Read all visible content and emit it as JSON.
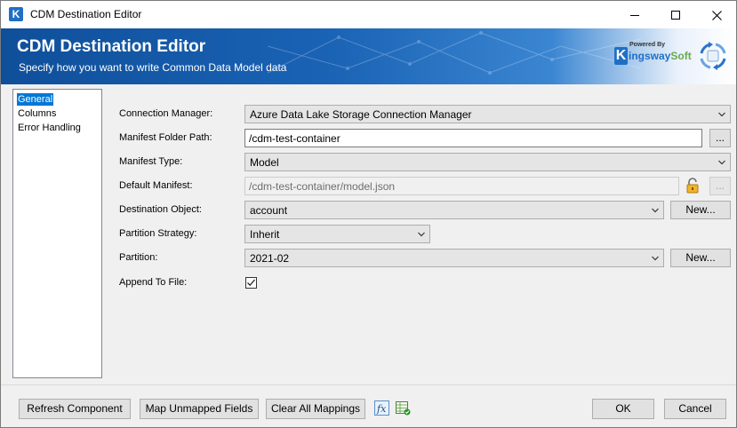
{
  "window": {
    "title": "CDM Destination Editor",
    "app_icon_letter": "K"
  },
  "banner": {
    "title": "CDM Destination Editor",
    "subtitle": "Specify how you want to write Common Data Model data",
    "brand_powered": "Powered By",
    "brand_name_main": "ingsway",
    "brand_name_soft": "Soft",
    "brand_letter": "K"
  },
  "nav": {
    "items": [
      {
        "label": "General",
        "selected": true
      },
      {
        "label": "Columns",
        "selected": false
      },
      {
        "label": "Error Handling",
        "selected": false
      }
    ]
  },
  "form": {
    "connection_manager": {
      "label": "Connection Manager:",
      "value": "Azure Data Lake Storage Connection Manager"
    },
    "manifest_folder_path": {
      "label": "Manifest Folder Path:",
      "value": "/cdm-test-container",
      "browse_label": "..."
    },
    "manifest_type": {
      "label": "Manifest Type:",
      "value": "Model"
    },
    "default_manifest": {
      "label": "Default Manifest:",
      "value": "/cdm-test-container/model.json",
      "browse_label": "..."
    },
    "destination_object": {
      "label": "Destination Object:",
      "value": "account",
      "new_label": "New..."
    },
    "partition_strategy": {
      "label": "Partition Strategy:",
      "value": "Inherit"
    },
    "partition": {
      "label": "Partition:",
      "value": "2021-02",
      "new_label": "New..."
    },
    "append_to_file": {
      "label": "Append To File:",
      "checked": true
    }
  },
  "footer": {
    "refresh_label": "Refresh Component",
    "map_unmapped_label": "Map Unmapped Fields",
    "clear_mappings_label": "Clear All Mappings",
    "ok_label": "OK",
    "cancel_label": "Cancel"
  },
  "colors": {
    "accent": "#0078d7",
    "banner_dark": "#0f4f9a",
    "brand_blue": "#1f6fc5",
    "brand_green": "#6aa84f"
  }
}
